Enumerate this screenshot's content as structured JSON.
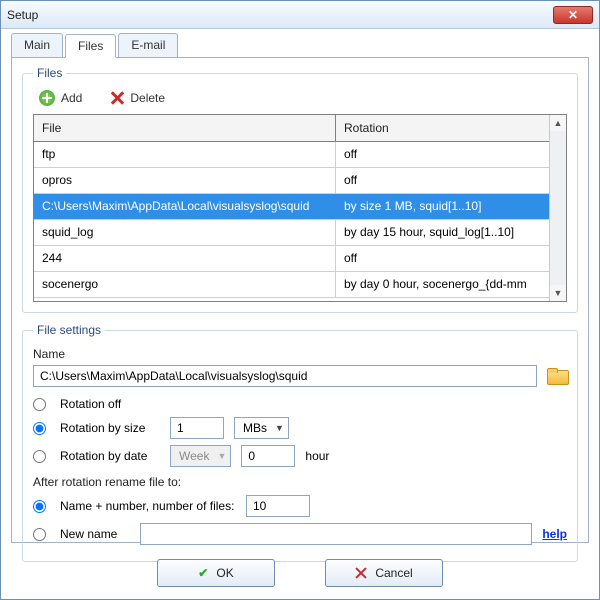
{
  "window": {
    "title": "Setup"
  },
  "tabs": {
    "main": "Main",
    "files": "Files",
    "email": "E-mail",
    "active": "files"
  },
  "files_group": {
    "legend": "Files",
    "add_label": "Add",
    "delete_label": "Delete",
    "columns": {
      "file": "File",
      "rotation": "Rotation"
    },
    "rows": [
      {
        "file": "ftp",
        "rotation": "off",
        "selected": false
      },
      {
        "file": "opros",
        "rotation": "off",
        "selected": false
      },
      {
        "file": "C:\\Users\\Maxim\\AppData\\Local\\visualsyslog\\squid",
        "rotation": "by size 1 MB, squid[1..10]",
        "selected": true
      },
      {
        "file": "squid_log",
        "rotation": "by day 15 hour, squid_log[1..10]",
        "selected": false
      },
      {
        "file": "244",
        "rotation": "off",
        "selected": false
      },
      {
        "file": "socenergo",
        "rotation": "by day 0 hour, socenergo_{dd-mm",
        "selected": false
      }
    ]
  },
  "file_settings": {
    "legend": "File settings",
    "name_label": "Name",
    "name_value": "C:\\Users\\Maxim\\AppData\\Local\\visualsyslog\\squid",
    "rotation_off_label": "Rotation off",
    "rotation_size_label": "Rotation by size",
    "rotation_size_value": "1",
    "rotation_size_unit": "MBs",
    "rotation_date_label": "Rotation by date",
    "rotation_date_period": "Week",
    "rotation_date_hour_value": "0",
    "rotation_date_hour_label": "hour",
    "rotation_selected": "size",
    "after_label": "After rotation rename file to:",
    "rename_number_label": "Name + number, number of files:",
    "rename_number_value": "10",
    "rename_newname_label": "New name",
    "rename_newname_value": "",
    "rename_selected": "number",
    "help_label": "help"
  },
  "footer": {
    "ok": "OK",
    "cancel": "Cancel"
  }
}
